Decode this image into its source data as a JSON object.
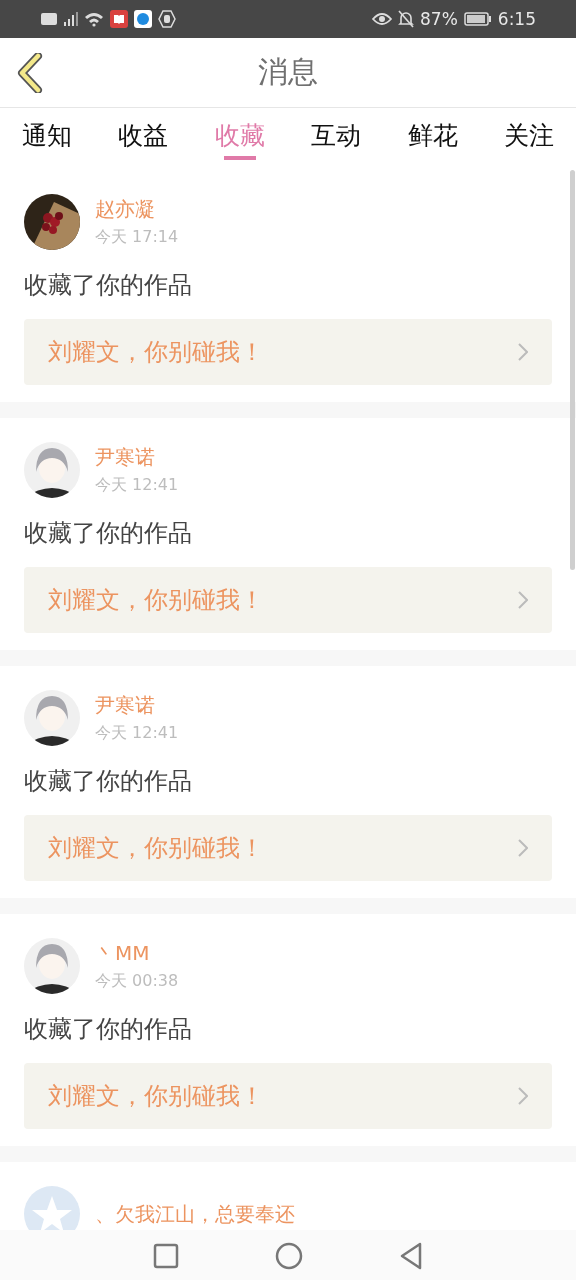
{
  "status_bar": {
    "battery": "87%",
    "time": "6:15"
  },
  "header": {
    "title": "消息"
  },
  "tabs": [
    {
      "label": "通知",
      "selected": false
    },
    {
      "label": "收益",
      "selected": false
    },
    {
      "label": "收藏",
      "selected": true
    },
    {
      "label": "互动",
      "selected": false
    },
    {
      "label": "鲜花",
      "selected": false
    },
    {
      "label": "关注",
      "selected": false
    }
  ],
  "messages": [
    {
      "avatar": {
        "kind": "flowers"
      },
      "name": "赵亦凝",
      "time": "今天 17:14",
      "action": "收藏了你的作品",
      "work": "刘耀文，你别碰我！"
    },
    {
      "avatar": {
        "kind": "figure"
      },
      "name": "尹寒诺",
      "time": "今天 12:41",
      "action": "收藏了你的作品",
      "work": "刘耀文，你别碰我！"
    },
    {
      "avatar": {
        "kind": "figure"
      },
      "name": "尹寒诺",
      "time": "今天 12:41",
      "action": "收藏了你的作品",
      "work": "刘耀文，你别碰我！"
    },
    {
      "avatar": {
        "kind": "figure"
      },
      "name": "丶MM",
      "time": "今天 00:38",
      "action": "收藏了你的作品",
      "work": "刘耀文，你别碰我！"
    },
    {
      "avatar": {
        "kind": "default"
      },
      "name": "、欠我江山，总要奉还"
    }
  ]
}
